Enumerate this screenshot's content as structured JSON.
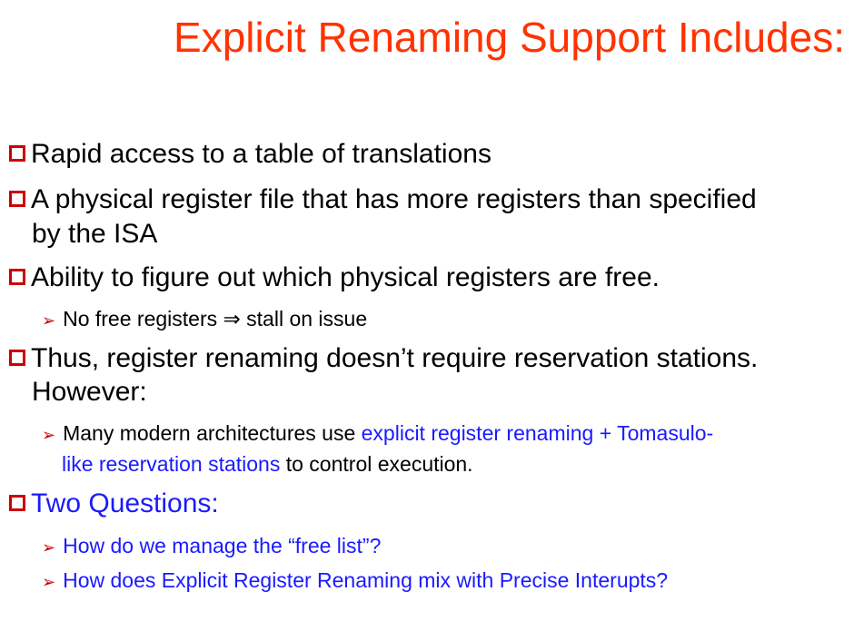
{
  "title": "Explicit Renaming Support Includes:",
  "bullets": {
    "b1": "Rapid access to a table of translations",
    "b2_line1": "A physical register file that has more registers than specified",
    "b2_line2": "by the ISA",
    "b3": "Ability to figure out which physical registers are free.",
    "b3_sub": "No free registers ⇒ stall on issue",
    "b4_line1": "Thus, register renaming doesn’t require reservation stations.",
    "b4_line2": "However:",
    "b4_sub_a": "Many modern architectures use ",
    "b4_sub_b": "explicit register renaming + Tomasulo-",
    "b4_sub_c": "like reservation stations",
    "b4_sub_d": " to control execution.",
    "b5": "Two Questions:",
    "b5_sub1": "How do we manage the “free list”?",
    "b5_sub2": "How does Explicit Register Renaming mix with Precise Interupts?"
  },
  "colors": {
    "title": "#ff3300",
    "checkbox": "#cc0000",
    "highlight": "#1a1aff"
  }
}
